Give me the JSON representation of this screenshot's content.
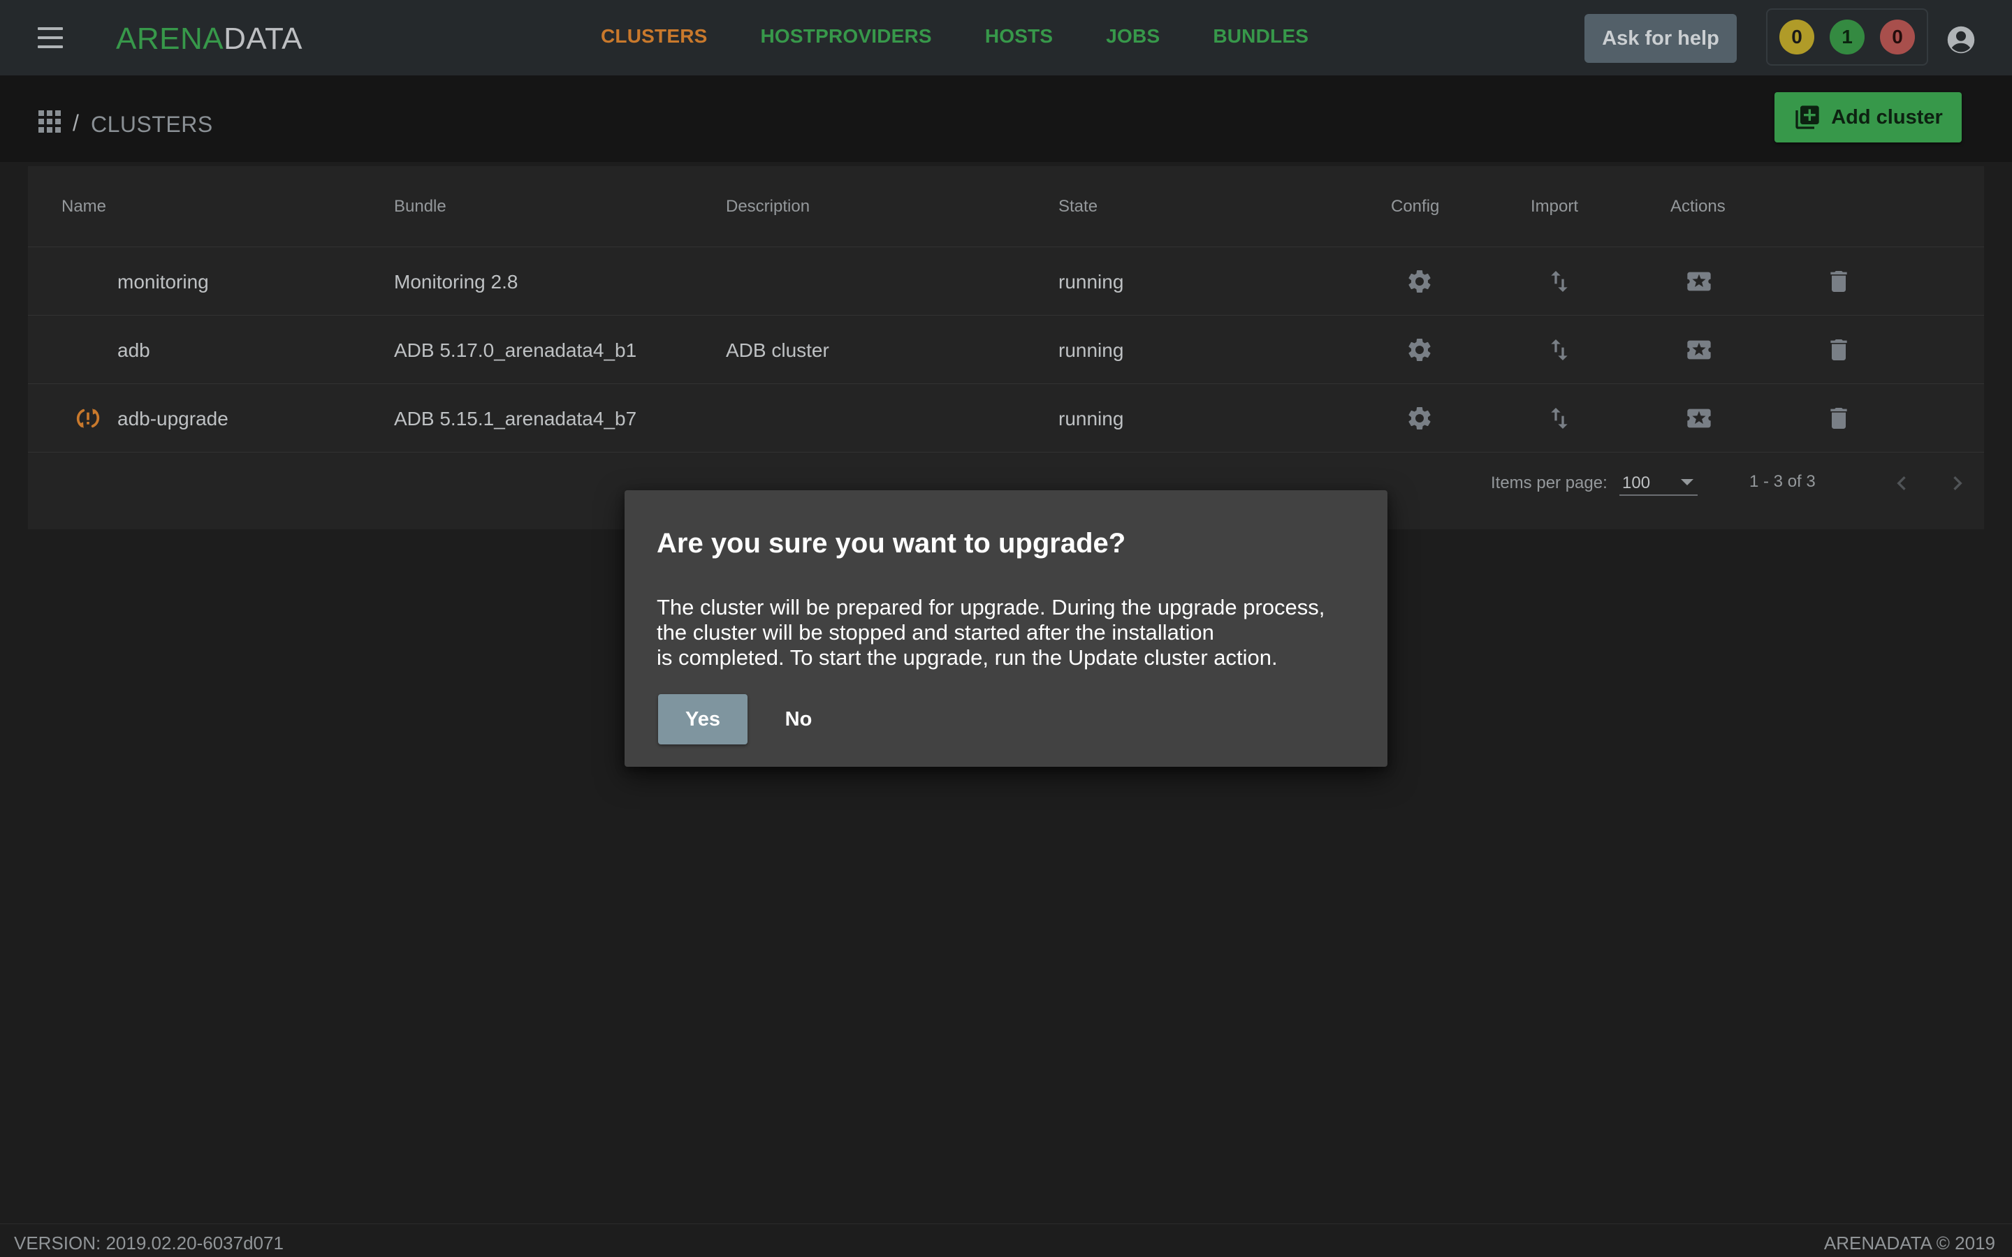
{
  "header": {
    "logo_part1": "ARENA",
    "logo_part2": "DATA",
    "nav": [
      {
        "label": "CLUSTERS",
        "active": true
      },
      {
        "label": "HOSTPROVIDERS",
        "active": false
      },
      {
        "label": "HOSTS",
        "active": false
      },
      {
        "label": "JOBS",
        "active": false
      },
      {
        "label": "BUNDLES",
        "active": false
      }
    ],
    "help_label": "Ask for help",
    "counters": [
      {
        "value": "0",
        "color": "#c9b12e"
      },
      {
        "value": "1",
        "color": "#3c9e4a"
      },
      {
        "value": "0",
        "color": "#c05a57"
      }
    ]
  },
  "breadcrumb": {
    "separator": "/",
    "title": "CLUSTERS",
    "add_label": "Add cluster"
  },
  "table": {
    "columns": [
      "Name",
      "Bundle",
      "Description",
      "State",
      "Config",
      "Import",
      "Actions"
    ],
    "rows": [
      {
        "name": "monitoring",
        "bundle": "Monitoring 2.8",
        "description": "",
        "state": "running",
        "upgrade": false
      },
      {
        "name": "adb",
        "bundle": "ADB 5.17.0_arenadata4_b1",
        "description": "ADB cluster",
        "state": "running",
        "upgrade": false
      },
      {
        "name": "adb-upgrade",
        "bundle": "ADB 5.15.1_arenadata4_b7",
        "description": "",
        "state": "running",
        "upgrade": true
      }
    ]
  },
  "paginator": {
    "items_label": "Items per page:",
    "page_size": "100",
    "range": "1 - 3 of 3"
  },
  "dialog": {
    "title": "Are you sure you want to upgrade?",
    "body_lines": [
      "The cluster will be prepared for upgrade. During the upgrade process,",
      "the cluster will be stopped and started after the installation",
      "is completed. To start the upgrade, run the Update cluster action."
    ],
    "yes_label": "Yes",
    "no_label": "No"
  },
  "footer": {
    "version": "VERSION: 2019.02.20-6037d071",
    "copyright": "ARENADATA © 2019"
  },
  "colors": {
    "accent_green": "#3fae55",
    "accent_orange": "#e58a33",
    "background": "#212121"
  }
}
